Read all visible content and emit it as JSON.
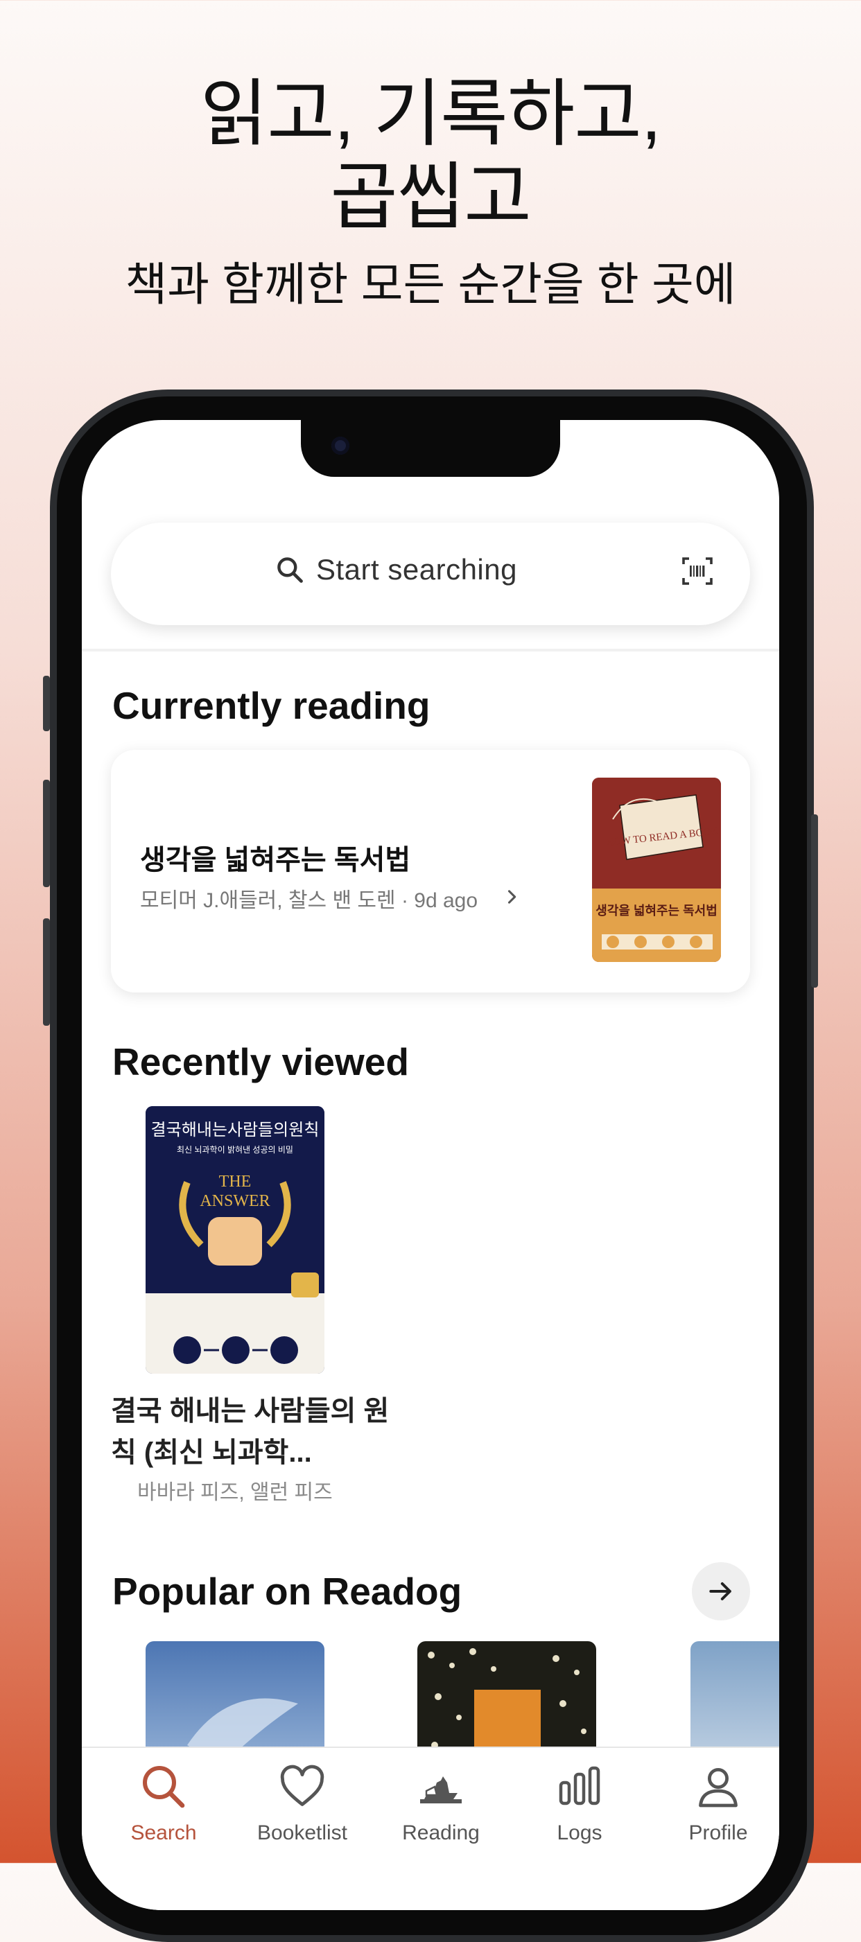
{
  "promo": {
    "headline_line1": "읽고, 기록하고,",
    "headline_line2": "곱씹고",
    "subhead": "책과 함께한 모든 순간을 한 곳에"
  },
  "search": {
    "placeholder": "Start searching",
    "icon": "search-icon",
    "scan_icon": "barcode-scan-icon"
  },
  "currently_reading": {
    "title": "Currently reading",
    "book": {
      "title": "생각을 넓혀주는 독서법",
      "meta": "모티머 J.애들러, 찰스 밴 도렌 · 9d ago",
      "cover_text_en": "HOW TO READ A BOOK",
      "cover_text_ko": "생각을 넓혀주는 독서법"
    }
  },
  "recently_viewed": {
    "title": "Recently viewed",
    "book": {
      "title": "결국 해내는 사람들의 원칙 (최신 뇌과학...",
      "author": "바바라 피즈, 앨런 피즈",
      "cover_top": "결국해내는사람들의원칙",
      "cover_sub": "최신 뇌과학이 밝혀낸 성공의 비밀",
      "cover_en1": "THE",
      "cover_en2": "ANSWER"
    }
  },
  "popular": {
    "title": "Popular on Readog"
  },
  "tabs": [
    {
      "label": "Search",
      "icon": "search-icon",
      "active": true
    },
    {
      "label": "Booketlist",
      "icon": "heart-icon",
      "active": false
    },
    {
      "label": "Reading",
      "icon": "dog-reading-icon",
      "active": false
    },
    {
      "label": "Logs",
      "icon": "bar-chart-icon",
      "active": false
    },
    {
      "label": "Profile",
      "icon": "person-icon",
      "active": false
    }
  ],
  "colors": {
    "accent": "#b5533c",
    "background_gradient_end": "#d4542f"
  }
}
